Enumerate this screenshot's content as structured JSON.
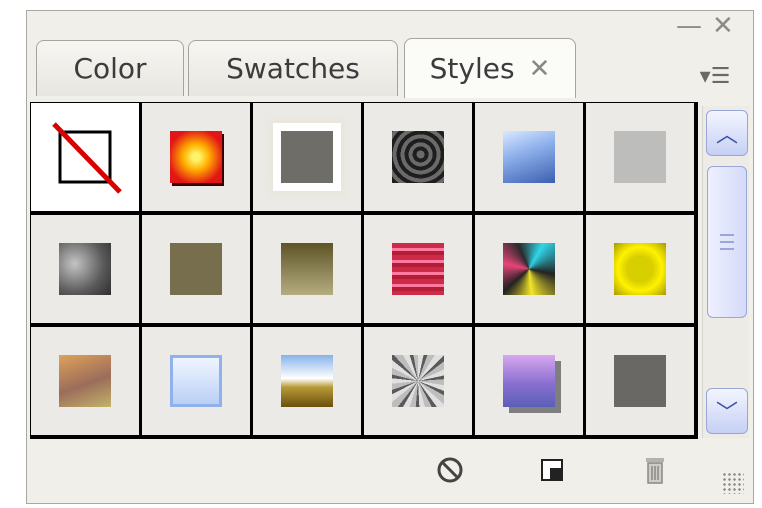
{
  "window": {
    "minimize_glyph": "—",
    "close_glyph": "✕"
  },
  "tabs": [
    {
      "label": "Color",
      "active": false
    },
    {
      "label": "Swatches",
      "active": false
    },
    {
      "label": "Styles",
      "active": true,
      "close_glyph": "✕"
    }
  ],
  "panel_menu": {
    "glyph": "▾☰"
  },
  "styles": [
    {
      "name": "none",
      "icon": "none-style-icon"
    },
    {
      "name": "red-orange glow",
      "colors": [
        "#ffe23a",
        "#e21616"
      ]
    },
    {
      "name": "gray with white glow",
      "colors": [
        "#6f6d68",
        "#ffffff"
      ]
    },
    {
      "name": "dark spiral",
      "colors": [
        "#5a5a5a",
        "#1c1c1c"
      ]
    },
    {
      "name": "blue gloss",
      "colors": [
        "#a5c4f0",
        "#3b5fb0"
      ]
    },
    {
      "name": "light gray",
      "colors": [
        "#bdbdbb",
        "#bdbdbb"
      ]
    },
    {
      "name": "smoky gray",
      "colors": [
        "#9b9b9b",
        "#3e3e3e"
      ]
    },
    {
      "name": "olive",
      "colors": [
        "#7a7250",
        "#6f6747"
      ]
    },
    {
      "name": "olive gradient",
      "colors": [
        "#5d5326",
        "#b5ad80"
      ]
    },
    {
      "name": "red stripes",
      "colors": [
        "#ce2b49",
        "#ff7aa0"
      ]
    },
    {
      "name": "abstract multicolor",
      "colors": [
        "#222222",
        "#2fd6e8",
        "#f2e52a",
        "#e8457a"
      ]
    },
    {
      "name": "yellow gloss",
      "colors": [
        "#fff200",
        "#b8a800"
      ]
    },
    {
      "name": "sunset gradient",
      "colors": [
        "#d9984f",
        "#9b6d5a",
        "#c2b36a"
      ]
    },
    {
      "name": "light blue bevel",
      "colors": [
        "#e8f2ff",
        "#9cbaf2"
      ]
    },
    {
      "name": "landscape",
      "colors": [
        "#a9ccf2",
        "#ffffff",
        "#8b6a16"
      ]
    },
    {
      "name": "noise texture",
      "colors": [
        "#d8d8d8",
        "#555555"
      ]
    },
    {
      "name": "purple with shadow",
      "colors": [
        "#d0a0e8",
        "#6060b8"
      ]
    },
    {
      "name": "dark gray",
      "colors": [
        "#6a6865",
        "#6a6865"
      ]
    }
  ],
  "footer": {
    "break_link_icon": "break-link-icon",
    "new_style_icon": "new-style-icon",
    "delete_icon": "trash-icon"
  }
}
